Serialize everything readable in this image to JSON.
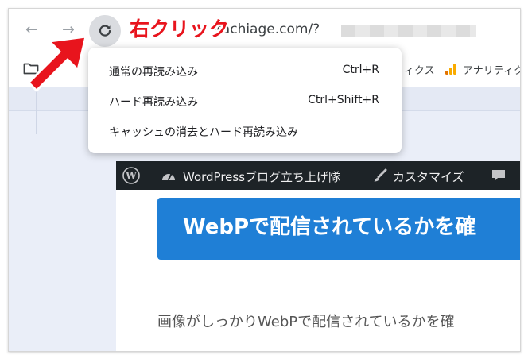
{
  "toolbar": {
    "back_icon": "←",
    "forward_icon": "→",
    "reload_icon": "reload-icon",
    "url": "-tachiage.com/?",
    "annotation": "右クリック"
  },
  "bookmarks": {
    "item_partial": "ィクス",
    "item_analytics": "アナリティク"
  },
  "context_menu": {
    "items": [
      {
        "label": "通常の再読み込み",
        "shortcut": "Ctrl+R"
      },
      {
        "label": "ハード再読み込み",
        "shortcut": "Ctrl+Shift+R"
      },
      {
        "label": "キャッシュの消去とハード再読み込み",
        "shortcut": ""
      }
    ]
  },
  "wp_admin_bar": {
    "site_name": "WordPressブログ立ち上げ隊",
    "customize": "カスタマイズ"
  },
  "article": {
    "title": "WebPで配信されているかを確",
    "body": "画像がしっかりWebPで配信されているかを確"
  },
  "colors": {
    "annotation_red": "#e8141d",
    "title_blue": "#1f7fd6",
    "wp_bar": "#1d2327",
    "analytics_orange": "#f9ab00"
  }
}
